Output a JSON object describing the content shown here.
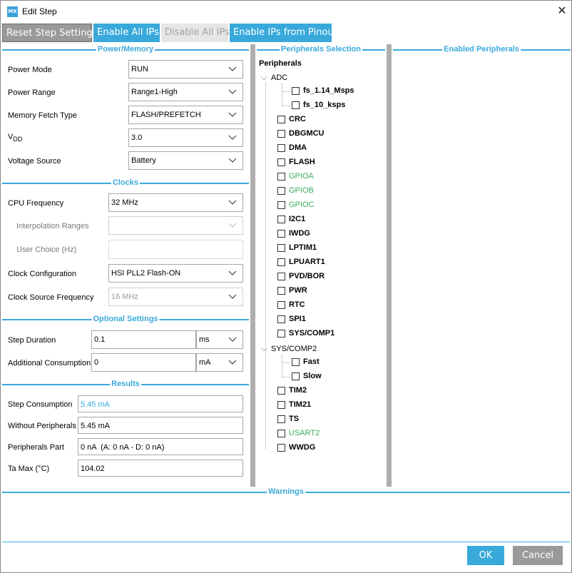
{
  "window": {
    "title": "Edit Step",
    "icon_text": "MX"
  },
  "toolbar": {
    "reset": "Reset Step Settings",
    "enable_all": "Enable All IPs",
    "disable_all": "Disable All IPs",
    "enable_pinout": "Enable IPs from Pinout"
  },
  "power_memory": {
    "title": "Power/Memory",
    "power_mode": {
      "label": "Power Mode",
      "value": "RUN"
    },
    "power_range": {
      "label": "Power Range",
      "value": "Range1-High"
    },
    "memory_fetch": {
      "label": "Memory Fetch Type",
      "value": "FLASH/PREFETCH"
    },
    "vdd": {
      "label": "V",
      "sub": "DD",
      "value": "3.0"
    },
    "voltage_source": {
      "label": "Voltage Source",
      "value": "Battery"
    }
  },
  "clocks": {
    "title": "Clocks",
    "cpu_freq": {
      "label": "CPU Frequency",
      "value": "32 MHz"
    },
    "interp": {
      "label": "Interpolation Ranges",
      "value": ""
    },
    "user_choice": {
      "label": "User Choice (Hz)",
      "value": ""
    },
    "clock_config": {
      "label": "Clock Configuration",
      "value": "HSI PLL2 Flash-ON"
    },
    "clock_source": {
      "label": "Clock Source Frequency",
      "value": "16 MHz"
    }
  },
  "optional": {
    "title": "Optional Settings",
    "step_duration": {
      "label": "Step Duration",
      "value": "0.1",
      "unit": "ms"
    },
    "additional": {
      "label": "Additional Consumption",
      "value": "0",
      "unit": "mA"
    }
  },
  "results": {
    "title": "Results",
    "step_consumption": {
      "label": "Step Consumption",
      "value": "5.45 mA"
    },
    "without_peripherals": {
      "label": "Without Peripherals",
      "value": "5.45 mA"
    },
    "peripherals_part": {
      "label": "Peripherals Part",
      "value": "0 nA  (A: 0 nA - D: 0 nA)"
    },
    "ta_max": {
      "label": "Ta Max (°C)",
      "value": "104.02"
    }
  },
  "peripherals_selection": {
    "title": "Peripherals Selection",
    "root": "Peripherals",
    "adc": {
      "label": "ADC",
      "children": [
        "fs_1.14_Msps",
        "fs_10_ksps"
      ]
    },
    "items_a": [
      {
        "label": "CRC",
        "color": ""
      },
      {
        "label": "DBGMCU",
        "color": ""
      },
      {
        "label": "DMA",
        "color": ""
      },
      {
        "label": "FLASH",
        "color": ""
      },
      {
        "label": "GPIOA",
        "color": "#3cab5e"
      },
      {
        "label": "GPIOB",
        "color": "#3cab5e"
      },
      {
        "label": "GPIOC",
        "color": "#3cab5e"
      },
      {
        "label": "I2C1",
        "color": ""
      },
      {
        "label": "IWDG",
        "color": ""
      },
      {
        "label": "LPTIM1",
        "color": ""
      },
      {
        "label": "LPUART1",
        "color": ""
      },
      {
        "label": "PVD/BOR",
        "color": ""
      },
      {
        "label": "PWR",
        "color": ""
      },
      {
        "label": "RTC",
        "color": ""
      },
      {
        "label": "SPI1",
        "color": ""
      },
      {
        "label": "SYS/COMP1",
        "color": ""
      }
    ],
    "sys_comp2": {
      "label": "SYS/COMP2",
      "children": [
        "Fast",
        "Slow"
      ]
    },
    "items_b": [
      {
        "label": "TIM2",
        "color": ""
      },
      {
        "label": "TIM21",
        "color": ""
      },
      {
        "label": "TS",
        "color": ""
      },
      {
        "label": "USART2",
        "color": "#3cab5e"
      },
      {
        "label": "WWDG",
        "color": ""
      }
    ]
  },
  "enabled_peripherals": {
    "title": "Enabled Peripherals"
  },
  "warnings": {
    "title": "Warnings"
  },
  "footer": {
    "ok": "OK",
    "cancel": "Cancel"
  },
  "colors": {
    "accent": "#39a9db",
    "green": "#3cab5e",
    "gray_button": "#9a9a9a"
  }
}
